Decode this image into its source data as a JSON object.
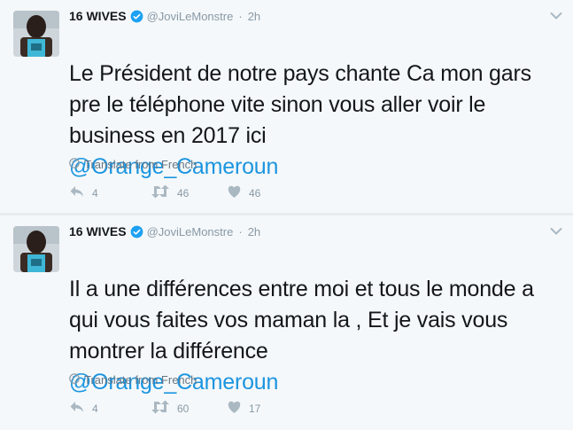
{
  "tweets": [
    {
      "author_name": "16 WIVES",
      "handle": "@JoviLeMonstre",
      "separator": "·",
      "time": "2h",
      "text_lines": "Le Président de notre pays chante Ca mon gars pre le téléphone vite sinon vous aller voir le business en 2017 ici",
      "mention": "@Orange_Cameroun",
      "translate_label": "Translate from French",
      "replies": "4",
      "retweets": "46",
      "likes": "46"
    },
    {
      "author_name": "16 WIVES",
      "handle": "@JoviLeMonstre",
      "separator": "·",
      "time": "2h",
      "text_lines": "Il a une différences entre moi et tous le monde a qui vous faites vos maman la , Et je vais vous montrer la différence",
      "mention": "@Orange_Cameroun",
      "translate_label": "Translate from French",
      "replies": "4",
      "retweets": "60",
      "likes": "17"
    }
  ],
  "colors": {
    "link": "#1b95e0",
    "muted": "#8899a6",
    "background": "#f5f8fa",
    "verified": "#1da1f2"
  },
  "icons": {
    "verified": "verified-badge-icon",
    "caret": "chevron-down-icon",
    "translate": "globe-icon",
    "reply": "reply-icon",
    "retweet": "retweet-icon",
    "like": "heart-icon"
  }
}
